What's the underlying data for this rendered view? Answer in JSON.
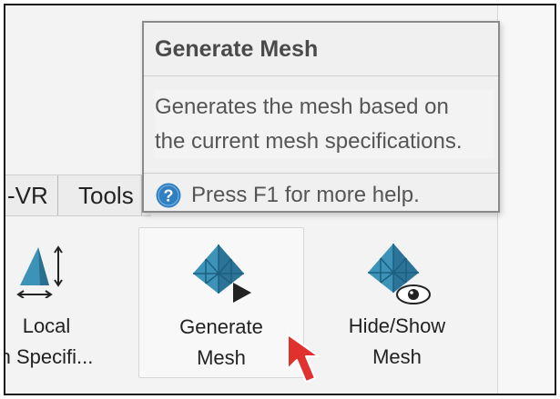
{
  "ribbon": {
    "tabs": [
      {
        "label": "-VR"
      },
      {
        "label": "Tools"
      }
    ],
    "buttons": {
      "local": {
        "line1": "Local",
        "line2": "h Specifi..."
      },
      "generate": {
        "line1": "Generate",
        "line2": "Mesh"
      },
      "hide_show": {
        "line1": "Hide/Show",
        "line2": "Mesh"
      }
    }
  },
  "tooltip": {
    "title": "Generate Mesh",
    "description_line1": "Generates the mesh based on",
    "description_line2": "the current mesh specifications.",
    "help_text": "Press F1 for more help."
  },
  "icons": {
    "local_icon": "triangle-with-dimension-arrows-icon",
    "generate_icon": "mesh-pyramid-play-icon",
    "hide_show_icon": "mesh-pyramid-eye-icon",
    "help_icon": "question-circle-icon",
    "cursor_icon": "red-cursor-arrow-icon"
  },
  "colors": {
    "mesh_blue": "#3d93b7",
    "help_blue": "#2f7fc1",
    "cursor_red": "#e0312f"
  }
}
